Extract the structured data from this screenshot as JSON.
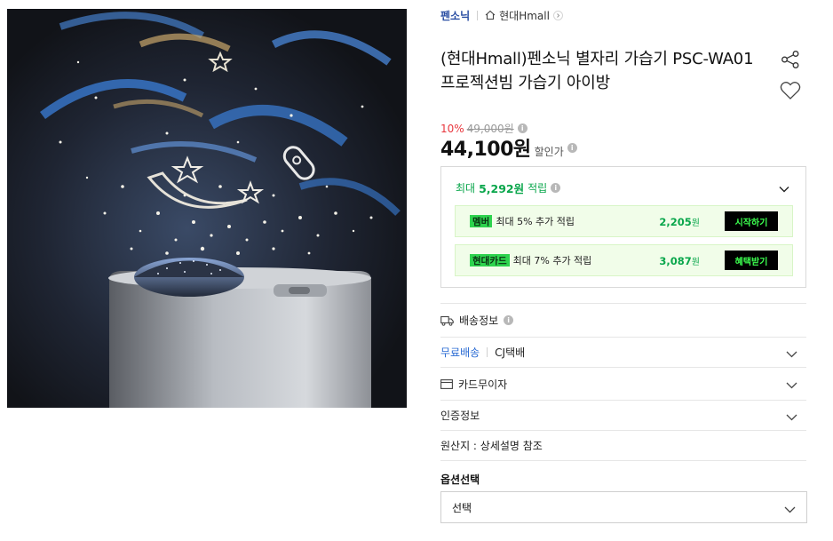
{
  "brand": {
    "name": "펜소닉",
    "store": "현대Hmall",
    "home_icon": "home-icon",
    "arrow_icon": "chevron-right-icon"
  },
  "product": {
    "title": "(현대Hmall)펜소닉 별자리 가습기 PSC-WA01 프로젝션빔 가습기 아이방",
    "image_desc_icon": "product-photo"
  },
  "price": {
    "discount_rate": "10%",
    "original": "49,000원",
    "sale": "44,100원",
    "sale_label": "할인가",
    "info_icon": "i"
  },
  "points": {
    "prefix": "최대",
    "amount": "5,292원",
    "suffix": "적립",
    "benefits": [
      {
        "tag": "멤버",
        "text": "최대 5% 추가 적립",
        "amount": "2,205",
        "unit": "원",
        "cta": "시작하기"
      },
      {
        "tag": "현대카드",
        "text": "최대 7% 추가 적립",
        "amount": "3,087",
        "unit": "원",
        "cta": "혜택받기"
      }
    ]
  },
  "shipping": {
    "header": "배송정보",
    "free": "무료배송",
    "carrier": "CJ택배"
  },
  "card_info": "카드무이자",
  "certification": "인증정보",
  "origin": "원산지 : 상세설명 참조",
  "option": {
    "label": "옵션선택",
    "selected": "선택"
  },
  "colors": {
    "accent_green": "#09a64b",
    "brand_blue": "#2a4ea3",
    "discount_red": "#e8363d"
  }
}
